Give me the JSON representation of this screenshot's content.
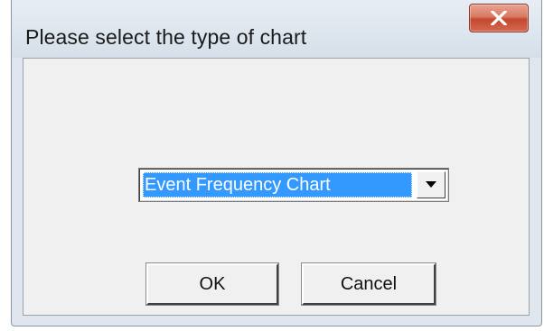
{
  "dialog": {
    "title": "Please select the type of chart",
    "close_icon": "close-icon"
  },
  "chart_type_select": {
    "selected": "Event Frequency Chart",
    "arrow_icon": "dropdown-arrow-icon"
  },
  "buttons": {
    "ok_label": "OK",
    "cancel_label": "Cancel"
  },
  "colors": {
    "selection": "#3399ff",
    "close_button": "#c4472f"
  }
}
